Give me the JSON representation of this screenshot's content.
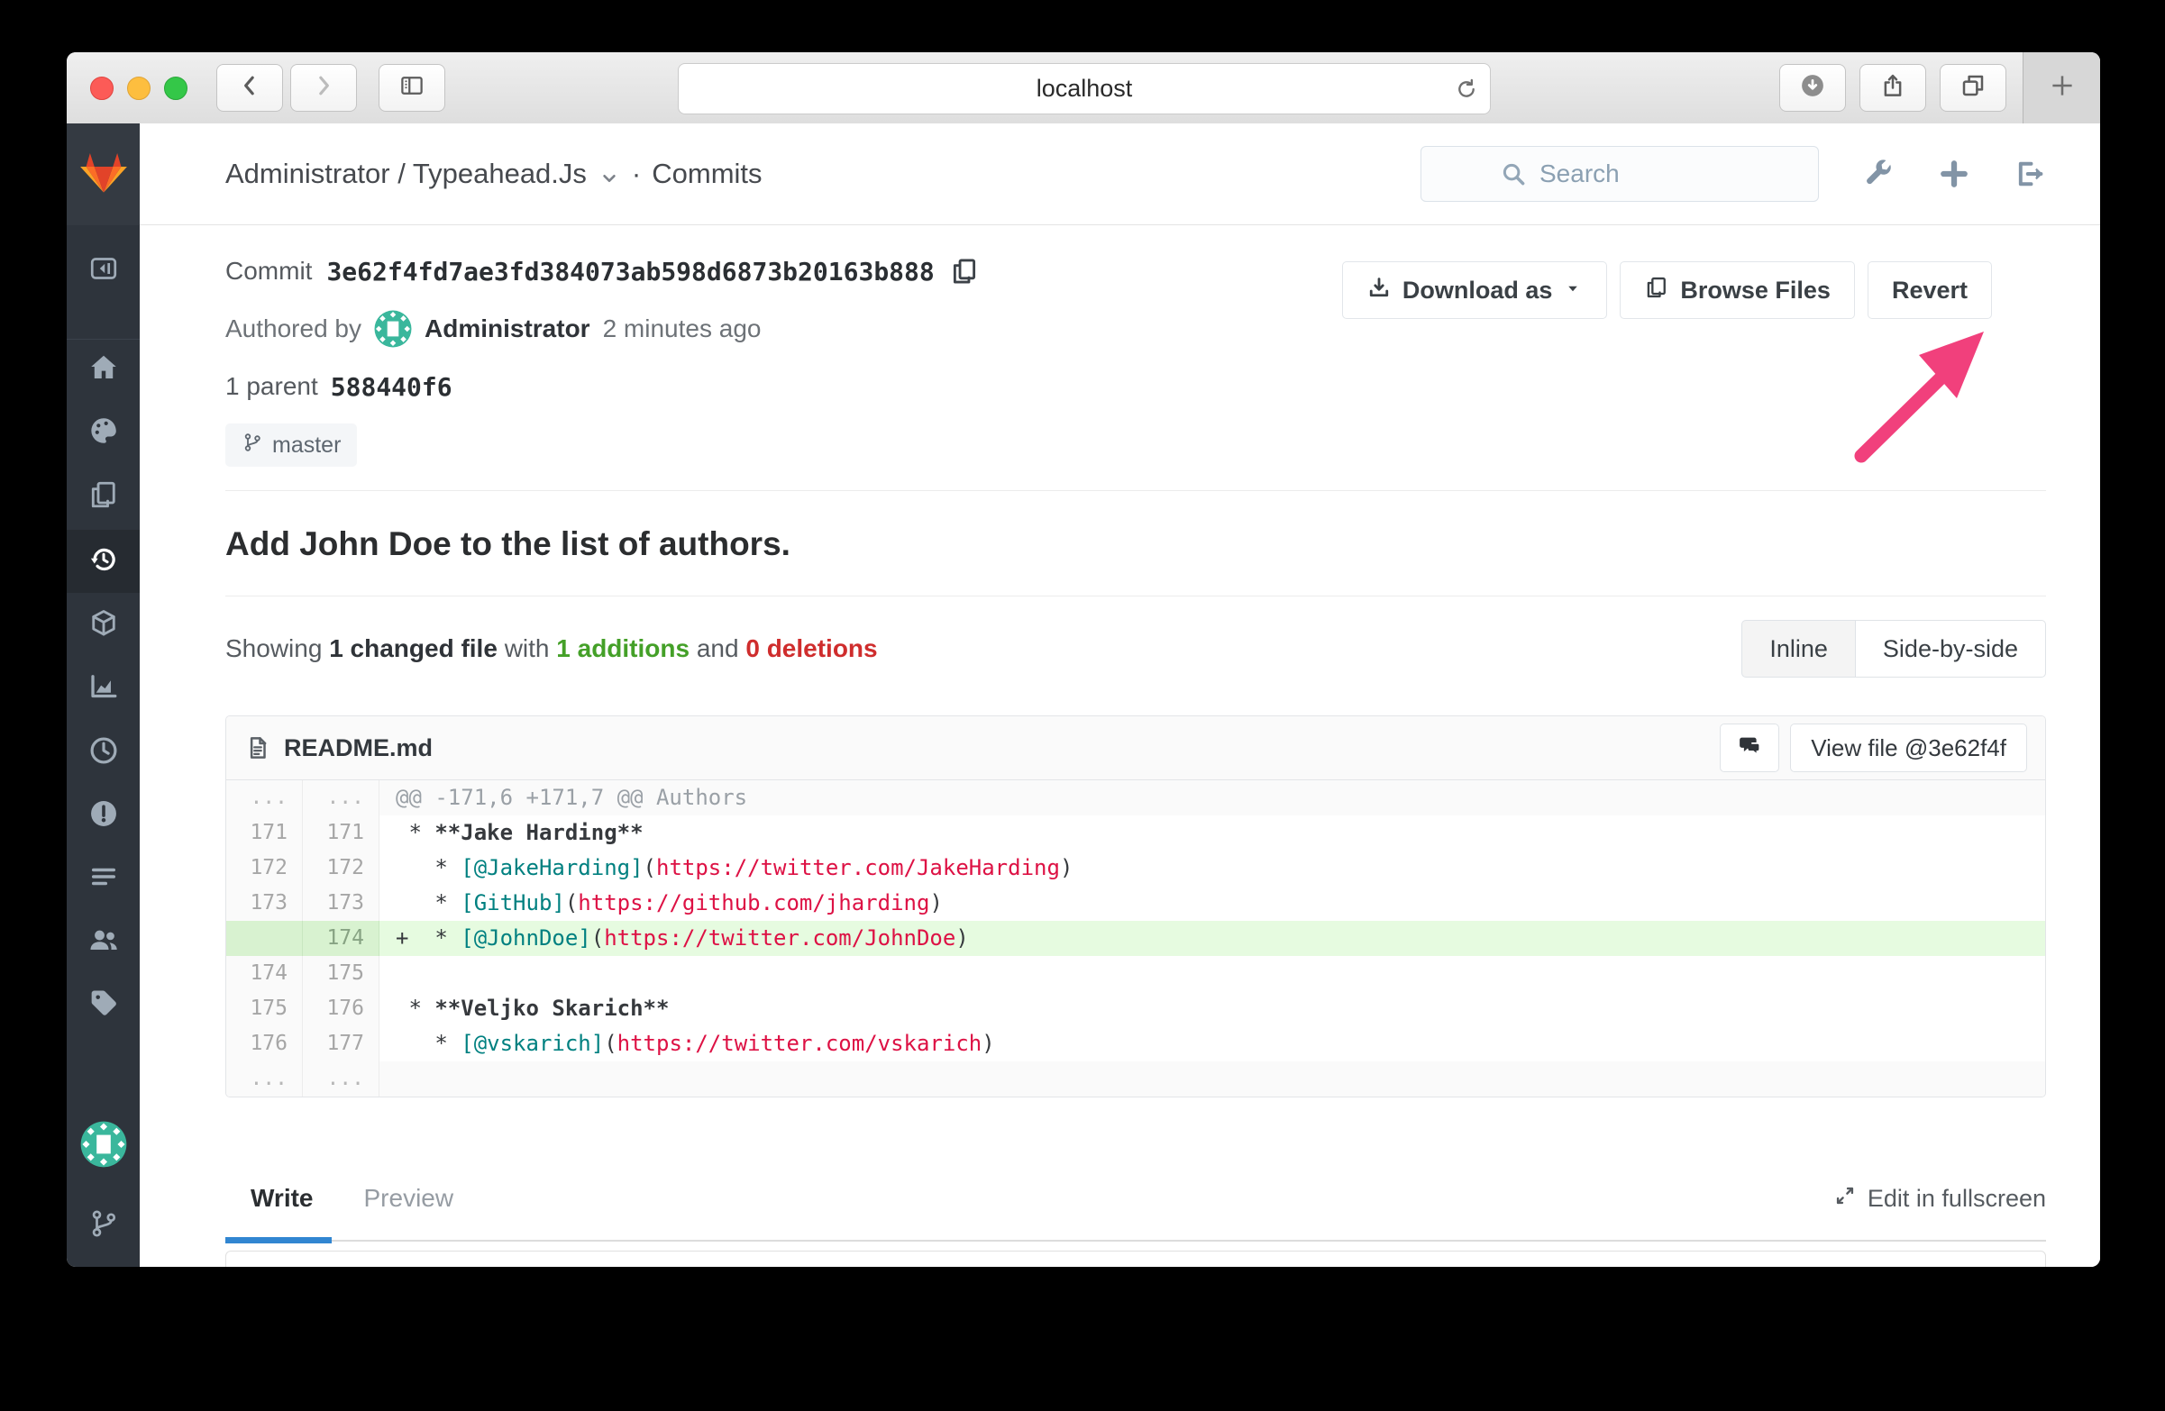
{
  "browser": {
    "url": "localhost"
  },
  "colors": {
    "brand_red": "#e24329",
    "brand_orange": "#fc6d26",
    "brand_yellow": "#fca326",
    "sidebar_bg": "#2e343c",
    "addition_green": "#44a028",
    "deletion_red": "#cf2d2d",
    "diff_add_bg": "#e6fbe0",
    "code_link_teal": "#008080",
    "code_url_red": "#dd1144",
    "arrow_pink": "#f1407c",
    "active_tab_blue": "#3186d1",
    "avatar_teal": "#3ab79c"
  },
  "header": {
    "project": "Administrator / Typeahead.Js",
    "separator": "·",
    "section": "Commits",
    "search_placeholder": "Search"
  },
  "sidebar": {
    "items": [
      {
        "name": "collapse",
        "icon": "collapse-icon"
      },
      {
        "name": "project-home",
        "icon": "home-icon"
      },
      {
        "name": "activity",
        "icon": "activity-icon"
      },
      {
        "name": "files",
        "icon": "files-icon"
      },
      {
        "name": "commits",
        "icon": "history-icon",
        "active": true
      },
      {
        "name": "builds",
        "icon": "cube-icon"
      },
      {
        "name": "graphs",
        "icon": "chart-icon"
      },
      {
        "name": "milestones",
        "icon": "clock-icon"
      },
      {
        "name": "issues",
        "icon": "issue-icon"
      },
      {
        "name": "merge-requests",
        "icon": "list-icon"
      },
      {
        "name": "members",
        "icon": "users-icon"
      },
      {
        "name": "labels",
        "icon": "tag-icon"
      },
      {
        "name": "profile",
        "icon": "avatar-identicon"
      },
      {
        "name": "branches",
        "icon": "branch-icon"
      }
    ]
  },
  "commit": {
    "label": "Commit",
    "sha": "3e62f4fd7ae3fd384073ab598d6873b20163b888",
    "authored_by": "Authored by",
    "author": "Administrator",
    "time_ago": "2 minutes ago",
    "parent_label": "1 parent",
    "parent_sha": "588440f6",
    "branch": "master",
    "download_button": "Download as",
    "browse_button": "Browse Files",
    "revert_button": "Revert",
    "message": "Add John Doe to the list of authors."
  },
  "changes": {
    "showing": "Showing",
    "changed_files": "1 changed file",
    "with_word": "with",
    "additions": "1 additions",
    "and_word": "and",
    "deletions": "0 deletions",
    "inline": "Inline",
    "side_by_side": "Side-by-side"
  },
  "diff": {
    "filename": "README.md",
    "view_file": "View file @3e62f4f",
    "rows": [
      {
        "old": "...",
        "new": "...",
        "type": "match",
        "code": [
          [
            "@@ -171,6 +171,7 @@ Authors",
            "hunk"
          ]
        ]
      },
      {
        "old": "171",
        "new": "171",
        "type": "context",
        "code": [
          [
            " * ",
            "plain"
          ],
          [
            "**Jake Harding**",
            "bold"
          ]
        ]
      },
      {
        "old": "172",
        "new": "172",
        "type": "context",
        "code": [
          [
            "   * ",
            "plain"
          ],
          [
            "[@JakeHarding]",
            "link"
          ],
          [
            "(",
            "plain"
          ],
          [
            "https://twitter.com/JakeHarding",
            "url"
          ],
          [
            ")",
            "plain"
          ]
        ]
      },
      {
        "old": "173",
        "new": "173",
        "type": "context",
        "code": [
          [
            "   * ",
            "plain"
          ],
          [
            "[GitHub]",
            "link"
          ],
          [
            "(",
            "plain"
          ],
          [
            "https://github.com/jharding",
            "url"
          ],
          [
            ")",
            "plain"
          ]
        ]
      },
      {
        "old": "",
        "new": "174",
        "type": "add",
        "code": [
          [
            "+  * ",
            "plain"
          ],
          [
            "[@JohnDoe]",
            "link"
          ],
          [
            "(",
            "plain"
          ],
          [
            "https://twitter.com/JohnDoe",
            "url"
          ],
          [
            ")",
            "plain"
          ]
        ]
      },
      {
        "old": "174",
        "new": "175",
        "type": "context",
        "code": []
      },
      {
        "old": "175",
        "new": "176",
        "type": "context",
        "code": [
          [
            " * ",
            "plain"
          ],
          [
            "**Veljko Skarich**",
            "bold"
          ]
        ]
      },
      {
        "old": "176",
        "new": "177",
        "type": "context",
        "code": [
          [
            "   * ",
            "plain"
          ],
          [
            "[@vskarich]",
            "link"
          ],
          [
            "(",
            "plain"
          ],
          [
            "https://twitter.com/vskarich",
            "url"
          ],
          [
            ")",
            "plain"
          ]
        ]
      },
      {
        "old": "...",
        "new": "...",
        "type": "match",
        "code": []
      }
    ]
  },
  "editor": {
    "write_tab": "Write",
    "preview_tab": "Preview",
    "fullscreen": "Edit in fullscreen"
  }
}
